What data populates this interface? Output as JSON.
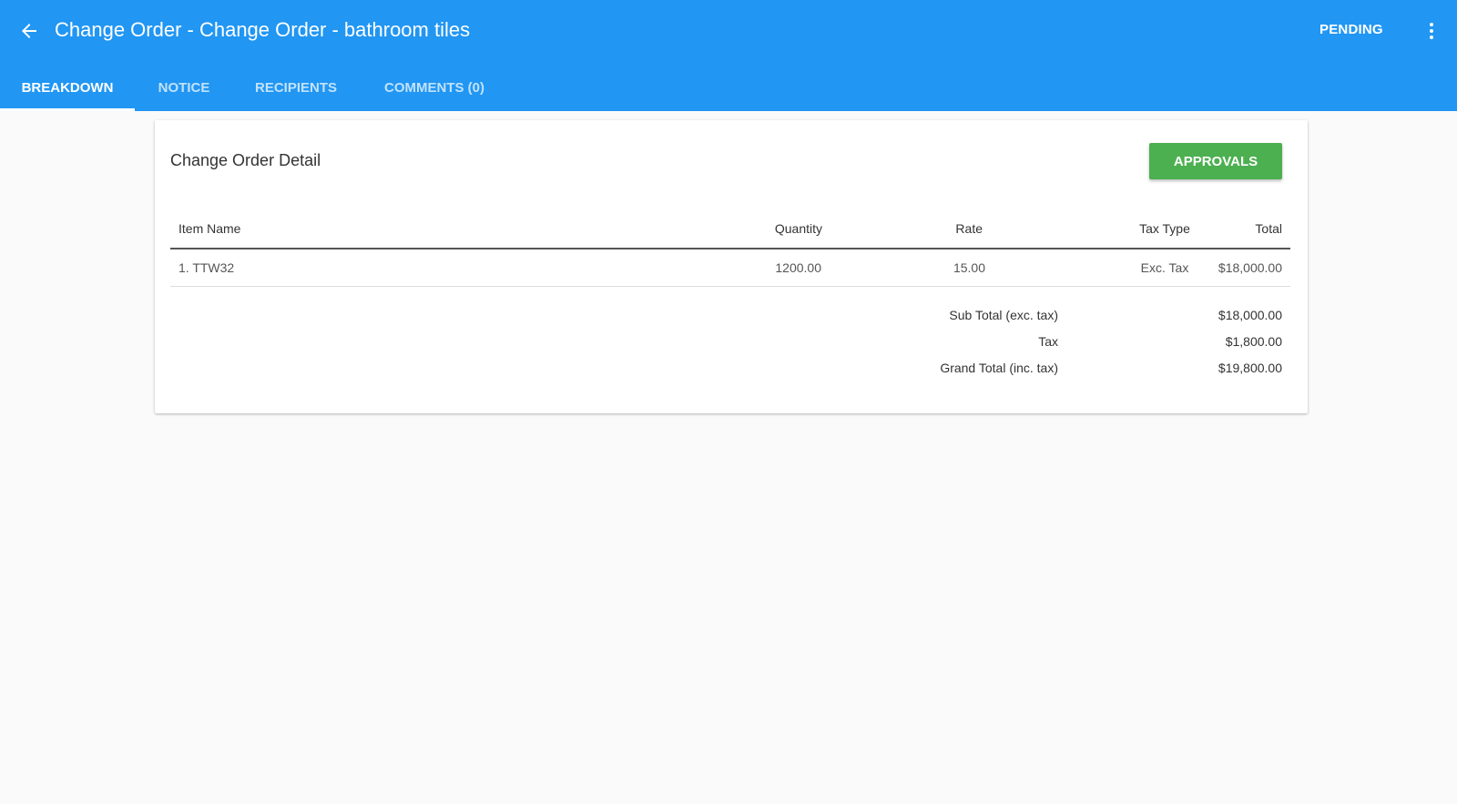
{
  "header": {
    "title": "Change Order - Change Order - bathroom tiles",
    "status": "PENDING",
    "background_color": "#2196f3"
  },
  "tabs": [
    {
      "label": "BREAKDOWN",
      "active": true
    },
    {
      "label": "NOTICE",
      "active": false
    },
    {
      "label": "RECIPIENTS",
      "active": false
    },
    {
      "label": "COMMENTS (0)",
      "active": false
    }
  ],
  "detail": {
    "title": "Change Order Detail",
    "approvals_label": "APPROVALS",
    "approvals_color": "#4caf50",
    "columns": {
      "item_name": "Item Name",
      "quantity": "Quantity",
      "rate": "Rate",
      "tax_type": "Tax Type",
      "total": "Total"
    },
    "rows": [
      {
        "item_name": "1. TTW32",
        "quantity": "1200.00",
        "rate": "15.00",
        "tax_type": "Exc. Tax",
        "total": "$18,000.00"
      }
    ],
    "summary": [
      {
        "label": "Sub Total (exc. tax)",
        "value": "$18,000.00"
      },
      {
        "label": "Tax",
        "value": "$1,800.00"
      },
      {
        "label": "Grand Total (inc. tax)",
        "value": "$19,800.00"
      }
    ]
  },
  "icons": {
    "back": "arrow-left-icon",
    "more": "more-vertical-icon"
  }
}
